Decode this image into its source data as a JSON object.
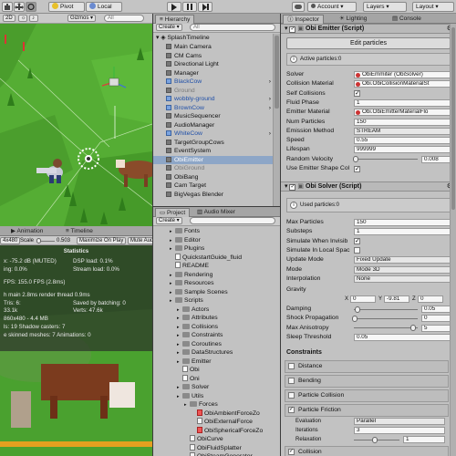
{
  "toolbar": {
    "tools": [
      "pivot-icon",
      "local-icon"
    ],
    "pivot_label": "Pivot",
    "local_label": "Local",
    "play_icons": [
      "play-icon",
      "pause-icon",
      "step-icon"
    ],
    "account_label": "Account",
    "layers_label": "Layers",
    "layout_label": "Layout"
  },
  "scene": {
    "shaded_label": "2D",
    "gizmos_label": "Gizmos",
    "search_placeholder": "All"
  },
  "game": {
    "tabs": [
      "Animation",
      "Timeline"
    ],
    "aspect_label": "4x480",
    "scale_label": "Scale",
    "scale_value": "0.503",
    "maximize_label": "Maximize On Play",
    "mute_label": "Mute Aud",
    "stats": {
      "title": "Statistics",
      "lines": [
        "x: -75.2 dB (MUTED)",
        "ing: 0.0%",
        "FPS: 155.0 FPS (2.8ms)",
        "h main 2.8ms  render thread 0.9ms",
        "Saved by batching: 0",
        "Verts: 47.6k",
        "ls: 19     Shadow casters: 7",
        "e skinned meshes: 7  Animations: 0"
      ],
      "right_lines": [
        "DSP load: 0.1%",
        "Stream load: 0.0%"
      ],
      "tris_label": "33.1k",
      "screen_label": "860x480 - 4.4 MB",
      "setpass_label": "Tris: 6:"
    }
  },
  "hierarchy": {
    "tab": "Hierarchy",
    "create_label": "Create",
    "search_placeholder": "All",
    "scene_name": "SplashTimeline",
    "items": [
      {
        "label": "Main Camera",
        "type": "cube",
        "indent": 1
      },
      {
        "label": "CM Cams",
        "type": "cube",
        "indent": 1
      },
      {
        "label": "Directional Light",
        "type": "cube",
        "indent": 1
      },
      {
        "label": "Manager",
        "type": "cube",
        "indent": 1
      },
      {
        "label": "BlackCow",
        "type": "pref",
        "indent": 1
      },
      {
        "label": "Ground",
        "type": "cube",
        "indent": 1,
        "muted": true
      },
      {
        "label": "wobbly-ground",
        "type": "pref",
        "indent": 1
      },
      {
        "label": "BrownCow",
        "type": "pref",
        "indent": 1
      },
      {
        "label": "MusicSequencer",
        "type": "cube",
        "indent": 1
      },
      {
        "label": "AudioManager",
        "type": "cube",
        "indent": 1
      },
      {
        "label": "WhiteCow",
        "type": "pref",
        "indent": 1
      },
      {
        "label": "TargetGroupCows",
        "type": "cube",
        "indent": 1
      },
      {
        "label": "EventSystem",
        "type": "cube",
        "indent": 1
      },
      {
        "label": "ObiEmitter",
        "type": "cube",
        "indent": 1,
        "selected": true
      },
      {
        "label": "ObiGround",
        "type": "cube",
        "indent": 1,
        "muted": true
      },
      {
        "label": "ObiBang",
        "type": "cube",
        "indent": 1
      },
      {
        "label": "Cam Target",
        "type": "cube",
        "indent": 1
      },
      {
        "label": "BigVegas Blender",
        "type": "cube",
        "indent": 1
      }
    ]
  },
  "project": {
    "tabs": [
      "Project",
      "Audio Mixer"
    ],
    "create_label": "Create",
    "items": [
      {
        "label": "Fonts",
        "kind": "folder",
        "indent": 1
      },
      {
        "label": "Editor",
        "kind": "folder",
        "indent": 1
      },
      {
        "label": "Plugins",
        "kind": "folder",
        "indent": 1
      },
      {
        "label": "QuickstartGuide_fluid",
        "kind": "file",
        "indent": 1
      },
      {
        "label": "README",
        "kind": "file",
        "indent": 1
      },
      {
        "label": "Rendering",
        "kind": "folder",
        "indent": 1
      },
      {
        "label": "Resources",
        "kind": "folder",
        "indent": 1
      },
      {
        "label": "Sample Scenes",
        "kind": "folder",
        "indent": 1
      },
      {
        "label": "Scripts",
        "kind": "folder",
        "indent": 1
      },
      {
        "label": "Actors",
        "kind": "folder",
        "indent": 2
      },
      {
        "label": "Attributes",
        "kind": "folder",
        "indent": 2
      },
      {
        "label": "Collisions",
        "kind": "folder",
        "indent": 2
      },
      {
        "label": "Constraints",
        "kind": "folder",
        "indent": 2
      },
      {
        "label": "Coroutines",
        "kind": "folder",
        "indent": 2
      },
      {
        "label": "DataStructures",
        "kind": "folder",
        "indent": 2
      },
      {
        "label": "Emitter",
        "kind": "folder",
        "indent": 2
      },
      {
        "label": "Obi",
        "kind": "file",
        "indent": 2
      },
      {
        "label": "Oni",
        "kind": "file",
        "indent": 2
      },
      {
        "label": "Solver",
        "kind": "folder",
        "indent": 2
      },
      {
        "label": "Utils",
        "kind": "folder",
        "indent": 2
      },
      {
        "label": "Forces",
        "kind": "folder",
        "indent": 3
      },
      {
        "label": "ObiAmbientForceZo",
        "kind": "red",
        "indent": 4
      },
      {
        "label": "ObiExternalForce",
        "kind": "cs",
        "indent": 4
      },
      {
        "label": "ObiSphericalForceZo",
        "kind": "red",
        "indent": 4
      },
      {
        "label": "ObiCurve",
        "kind": "cs",
        "indent": 3
      },
      {
        "label": "ObiFluidSplatter",
        "kind": "cs",
        "indent": 3
      },
      {
        "label": "ObiSteamGenerator",
        "kind": "cs",
        "indent": 3
      }
    ]
  },
  "inspector": {
    "tabs": [
      "Inspector",
      "Lighting",
      "Console"
    ],
    "component1_title": "Obi Emitter (Script)",
    "edit_particles_label": "Edit particles",
    "active_particles_label": "Active particles:0",
    "fields1": [
      {
        "label": "Solver",
        "value": "ObiEmmiter (ObiSolver)",
        "kind": "obj"
      },
      {
        "label": "Collision Material",
        "value": "Obi.ObiCollisionMaterialSt",
        "kind": "obj"
      },
      {
        "label": "Self Collisions",
        "value": "✓",
        "kind": "check"
      },
      {
        "label": "Fluid Phase",
        "value": "1",
        "kind": "text"
      },
      {
        "label": "Emitter Material",
        "value": "Obi.ObiEmitterMaterialFlo",
        "kind": "obj"
      },
      {
        "label": "Num Particles",
        "value": "150",
        "kind": "text"
      },
      {
        "label": "Emission Method",
        "value": "STREAM",
        "kind": "dd"
      },
      {
        "label": "Speed",
        "value": "0.55",
        "kind": "text"
      },
      {
        "label": "Lifespan",
        "value": "999999",
        "kind": "text"
      },
      {
        "label": "Random Velocity",
        "value": "0.008",
        "kind": "slider",
        "fraction": 0.02
      },
      {
        "label": "Use Emitter Shape Col",
        "value": "✓",
        "kind": "check"
      }
    ],
    "component2_title": "Obi Solver (Script)",
    "used_particles_label": "Used particles:0",
    "fields2": [
      {
        "label": "Max Particles",
        "value": "150",
        "kind": "text"
      },
      {
        "label": "Substeps",
        "value": "1",
        "kind": "text"
      },
      {
        "label": "Simulate When Invisib",
        "value": "✓",
        "kind": "check"
      },
      {
        "label": "Simulate In Local Spac",
        "value": "",
        "kind": "check"
      },
      {
        "label": "Update Mode",
        "value": "Fixed Update",
        "kind": "dd"
      },
      {
        "label": "Mode",
        "value": "Mode 3D",
        "kind": "dd"
      },
      {
        "label": "Interpolation",
        "value": "None",
        "kind": "dd"
      }
    ],
    "gravity_label": "Gravity",
    "gravity": {
      "x": "0",
      "y": "-9.81",
      "z": "0"
    },
    "fields3": [
      {
        "label": "Damping",
        "value": "0.05",
        "kind": "slider",
        "fraction": 0.05
      },
      {
        "label": "Shock Propagation",
        "value": "0",
        "kind": "slider",
        "fraction": 0.0
      },
      {
        "label": "Max Anisotropy",
        "value": "5",
        "kind": "slider",
        "fraction": 1.0
      },
      {
        "label": "Sleep Threshold",
        "value": "0.05",
        "kind": "text"
      }
    ],
    "constraints_label": "Constraints",
    "constraint_items": [
      {
        "label": "Distance",
        "checked": false
      },
      {
        "label": "Bending",
        "checked": false
      },
      {
        "label": "Particle Collision",
        "checked": false
      },
      {
        "label": "Particle Friction",
        "checked": true
      }
    ],
    "friction_fields": [
      {
        "label": "Evaluation",
        "value": "Parallel"
      },
      {
        "label": "Iterations",
        "value": "3"
      },
      {
        "label": "Relaxation",
        "value": "1",
        "fraction": 0.5
      }
    ],
    "collision_label": "Collision",
    "colors": {
      "accent": "#3d6fb6",
      "selection": "#8da6c7"
    }
  }
}
